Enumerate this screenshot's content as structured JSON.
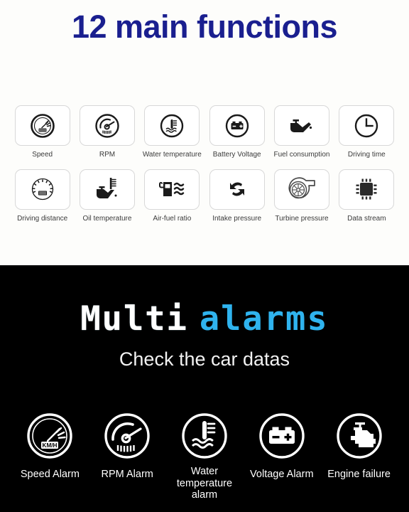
{
  "functions_section": {
    "title": "12 main functions",
    "title_color": "#1a1f8f",
    "items": [
      {
        "label": "Speed",
        "icon": "speedometer-icon"
      },
      {
        "label": "RPM",
        "icon": "tachometer-icon"
      },
      {
        "label": "Water temperature",
        "icon": "coolant-temp-icon"
      },
      {
        "label": "Battery Voltage",
        "icon": "battery-icon"
      },
      {
        "label": "Fuel consumption",
        "icon": "oil-can-icon"
      },
      {
        "label": "Driving time",
        "icon": "clock-icon"
      },
      {
        "label": "Driving distance",
        "icon": "odometer-icon"
      },
      {
        "label": "Oil temperature",
        "icon": "oil-temp-icon"
      },
      {
        "label": "Air-fuel ratio",
        "icon": "fuel-pump-waves-icon"
      },
      {
        "label": "Intake pressure",
        "icon": "recycle-arrows-icon"
      },
      {
        "label": "Turbine pressure",
        "icon": "turbocharger-icon"
      },
      {
        "label": "Data stream",
        "icon": "chip-icon"
      }
    ]
  },
  "alarms_section": {
    "heading_word_1": "Multi",
    "heading_word_2": "alarms",
    "heading_word_1_color": "#ffffff",
    "heading_word_2_color": "#2fb3ee",
    "subtitle": "Check the car datas",
    "background_color": "#000000",
    "items": [
      {
        "label": "Speed Alarm",
        "icon": "speed-alarm-icon",
        "gauge_unit": "KM/H"
      },
      {
        "label": "RPM Alarm",
        "icon": "rpm-alarm-icon"
      },
      {
        "label": "Water temperature alarm",
        "icon": "water-temp-alarm-icon",
        "line1": "Water",
        "line2": "temperature alarm"
      },
      {
        "label": "Voltage Alarm",
        "icon": "voltage-alarm-icon"
      },
      {
        "label": "Engine failure",
        "icon": "engine-failure-icon"
      }
    ]
  }
}
